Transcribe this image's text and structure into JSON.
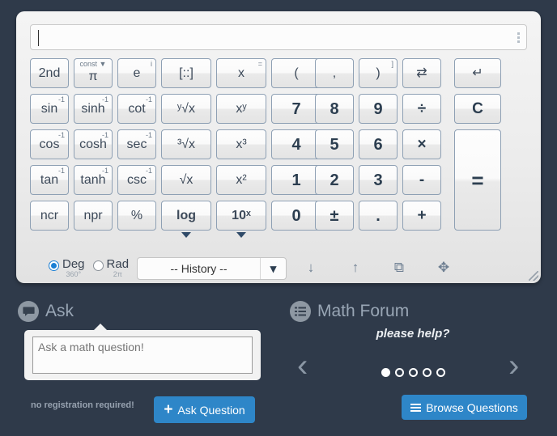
{
  "calculator": {
    "display": {
      "value": "",
      "placeholder": "",
      "menu_icon": "kebab-menu-icon"
    },
    "keys": [
      {
        "id": "2nd",
        "label": "2nd",
        "sup": "",
        "col": 0,
        "row": 0,
        "type": "fn"
      },
      {
        "id": "pi",
        "label": "π",
        "sup": "const ▼",
        "col": 1,
        "row": 0,
        "type": "fn",
        "supmid": true
      },
      {
        "id": "e",
        "label": "e",
        "sup": "i",
        "col": 2,
        "row": 0,
        "type": "fn"
      },
      {
        "id": "matrix",
        "label": "[::]",
        "sup": "",
        "col": 3,
        "row": 0,
        "type": "fn"
      },
      {
        "id": "x",
        "label": "x",
        "sup": "=",
        "col": 4,
        "row": 0,
        "type": "fn"
      },
      {
        "id": "lparen",
        "label": "(",
        "sup": "[",
        "col": 5,
        "row": 0,
        "type": "fn"
      },
      {
        "id": "comma",
        "label": ",",
        "sup": "",
        "col": 6,
        "row": 0,
        "type": "fn"
      },
      {
        "id": "rparen",
        "label": ")",
        "sup": "]",
        "col": 7,
        "row": 0,
        "type": "fn"
      },
      {
        "id": "swap",
        "label": "⇄",
        "sup": "",
        "col": 8,
        "row": 0,
        "type": "fn"
      },
      {
        "id": "enter",
        "label": "↵",
        "sup": "",
        "col": 9,
        "row": 0,
        "type": "fn"
      },
      {
        "id": "sin",
        "label": "sin",
        "sup": "-1",
        "col": 0,
        "row": 1,
        "type": "fn"
      },
      {
        "id": "sinh",
        "label": "sinh",
        "sup": "-1",
        "col": 1,
        "row": 1,
        "type": "fn"
      },
      {
        "id": "cot",
        "label": "cot",
        "sup": "-1",
        "col": 2,
        "row": 1,
        "type": "fn"
      },
      {
        "id": "ynthroot",
        "label": "ʸ√x",
        "sup": "",
        "col": 3,
        "row": 1,
        "type": "fn"
      },
      {
        "id": "xpowy",
        "label": "xʸ",
        "sup": "",
        "col": 4,
        "row": 1,
        "type": "fn"
      },
      {
        "id": "7",
        "label": "7",
        "sup": "",
        "col": 5,
        "row": 1,
        "type": "num"
      },
      {
        "id": "8",
        "label": "8",
        "sup": "",
        "col": 6,
        "row": 1,
        "type": "num"
      },
      {
        "id": "9",
        "label": "9",
        "sup": "",
        "col": 7,
        "row": 1,
        "type": "num"
      },
      {
        "id": "divide",
        "label": "÷",
        "sup": "",
        "col": 8,
        "row": 1,
        "type": "op"
      },
      {
        "id": "clear",
        "label": "C",
        "sup": "",
        "col": 9,
        "row": 1,
        "type": "op"
      },
      {
        "id": "cos",
        "label": "cos",
        "sup": "-1",
        "col": 0,
        "row": 2,
        "type": "fn"
      },
      {
        "id": "cosh",
        "label": "cosh",
        "sup": "-1",
        "col": 1,
        "row": 2,
        "type": "fn"
      },
      {
        "id": "sec",
        "label": "sec",
        "sup": "-1",
        "col": 2,
        "row": 2,
        "type": "fn"
      },
      {
        "id": "cuberoot",
        "label": "³√x",
        "sup": "",
        "col": 3,
        "row": 2,
        "type": "fn"
      },
      {
        "id": "xcubed",
        "label": "x³",
        "sup": "",
        "col": 4,
        "row": 2,
        "type": "fn"
      },
      {
        "id": "4",
        "label": "4",
        "sup": "",
        "col": 5,
        "row": 2,
        "type": "num"
      },
      {
        "id": "5",
        "label": "5",
        "sup": "",
        "col": 6,
        "row": 2,
        "type": "num"
      },
      {
        "id": "6",
        "label": "6",
        "sup": "",
        "col": 7,
        "row": 2,
        "type": "num"
      },
      {
        "id": "multiply",
        "label": "×",
        "sup": "",
        "col": 8,
        "row": 2,
        "type": "op"
      },
      {
        "id": "tan",
        "label": "tan",
        "sup": "-1",
        "col": 0,
        "row": 3,
        "type": "fn"
      },
      {
        "id": "tanh",
        "label": "tanh",
        "sup": "-1",
        "col": 1,
        "row": 3,
        "type": "fn"
      },
      {
        "id": "csc",
        "label": "csc",
        "sup": "-1",
        "col": 2,
        "row": 3,
        "type": "fn"
      },
      {
        "id": "sqrt",
        "label": "√x",
        "sup": "",
        "col": 3,
        "row": 3,
        "type": "fn"
      },
      {
        "id": "xsquared",
        "label": "x²",
        "sup": "",
        "col": 4,
        "row": 3,
        "type": "fn"
      },
      {
        "id": "1",
        "label": "1",
        "sup": "",
        "col": 5,
        "row": 3,
        "type": "num"
      },
      {
        "id": "2",
        "label": "2",
        "sup": "",
        "col": 6,
        "row": 3,
        "type": "num"
      },
      {
        "id": "3",
        "label": "3",
        "sup": "",
        "col": 7,
        "row": 3,
        "type": "num"
      },
      {
        "id": "minus",
        "label": "-",
        "sup": "",
        "col": 8,
        "row": 3,
        "type": "op"
      },
      {
        "id": "ncr",
        "label": "ncr",
        "sup": "",
        "col": 0,
        "row": 4,
        "type": "fn"
      },
      {
        "id": "npr",
        "label": "npr",
        "sup": "",
        "col": 1,
        "row": 4,
        "type": "fn"
      },
      {
        "id": "percent",
        "label": "%",
        "sup": "",
        "col": 2,
        "row": 4,
        "type": "fn"
      },
      {
        "id": "log",
        "label": "log",
        "sup": "",
        "col": 3,
        "row": 4,
        "type": "fn",
        "bold": true,
        "expander": true
      },
      {
        "id": "tenpowx",
        "label": "10ˣ",
        "sup": "",
        "col": 4,
        "row": 4,
        "type": "fn",
        "bold": true,
        "expander": true
      },
      {
        "id": "0",
        "label": "0",
        "sup": "",
        "col": 5,
        "row": 4,
        "type": "num"
      },
      {
        "id": "plusminus",
        "label": "±",
        "sup": "",
        "col": 6,
        "row": 4,
        "type": "num"
      },
      {
        "id": "decimal",
        "label": ".",
        "sup": "",
        "col": 7,
        "row": 4,
        "type": "num"
      },
      {
        "id": "plus",
        "label": "+",
        "sup": "",
        "col": 8,
        "row": 4,
        "type": "op"
      }
    ],
    "equals_key": {
      "id": "equals",
      "label": "="
    },
    "angle_mode": {
      "selected": "Deg",
      "options": [
        {
          "label": "Deg",
          "sub": "360°",
          "selected": true
        },
        {
          "label": "Rad",
          "sub": "2π",
          "selected": false
        }
      ]
    },
    "history": {
      "label": "-- History --",
      "caret": "chevron-down-icon"
    },
    "tools": [
      {
        "id": "scroll-down",
        "icon": "↓",
        "name": "arrow-down-icon"
      },
      {
        "id": "scroll-up",
        "icon": "↑",
        "name": "arrow-up-icon"
      },
      {
        "id": "save",
        "icon": "⧉",
        "name": "save-icon"
      },
      {
        "id": "fullscreen",
        "icon": "✥",
        "name": "move-icon"
      }
    ]
  },
  "ask": {
    "title": "Ask",
    "icon": "speech-bubble-icon",
    "textarea_value": "Ask a math question!",
    "textarea_placeholder": "Ask a math question!",
    "note": "no registration required!",
    "button_label": "Ask Question",
    "button_icon": "plus-icon"
  },
  "forum": {
    "title": "Math Forum",
    "icon": "list-icon",
    "quote": "please help?",
    "prev_arrow": "‹",
    "next_arrow": "›",
    "dots_total": 5,
    "dots_active": 1,
    "button_label": "Browse Questions",
    "button_icon": "list-icon"
  },
  "theme": {
    "background": "#2f3a4a",
    "card": "#36414f",
    "accent": "#2e86c8",
    "panel": "#ececec",
    "key_text": "#31455c"
  }
}
